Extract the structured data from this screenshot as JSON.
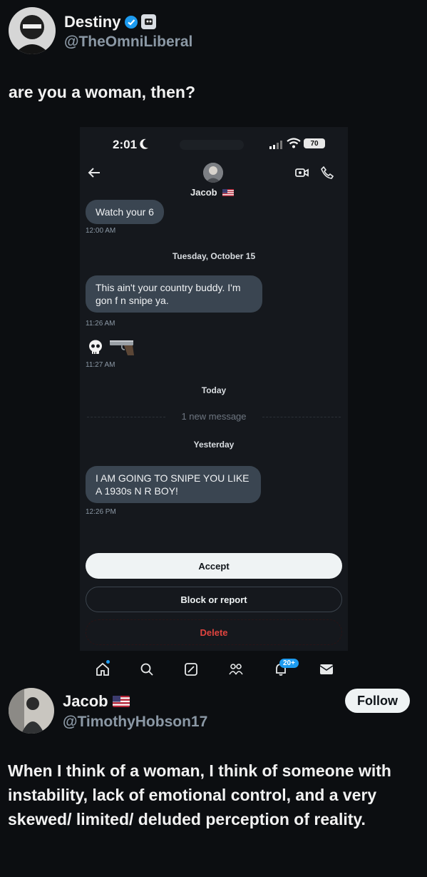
{
  "post": {
    "display_name": "Destiny",
    "handle": "@TheOmniLiberal",
    "text": "are you a woman, then?"
  },
  "screenshot": {
    "status": {
      "time": "2:01",
      "battery": "70"
    },
    "chat": {
      "contact_name": "Jacob",
      "messages": [
        {
          "text": "Watch your 6",
          "time": "12:00 AM"
        },
        {
          "text": "This ain't your country buddy. I'm gon f       n snipe ya.",
          "time": "11:26 AM"
        },
        {
          "text": "💀 🔫",
          "time": "11:27 AM"
        },
        {
          "text": "I AM GOING TO SNIPE YOU LIKE A 1930s N         R BOY!",
          "time": "12:26 PM"
        }
      ],
      "day_separators": [
        "Tuesday, October 15",
        "Today",
        "Yesterday"
      ],
      "new_message_label": "1 new message"
    },
    "actions": {
      "accept": "Accept",
      "block_report": "Block or report",
      "delete": "Delete"
    },
    "tabbar": {
      "notification_count": "20+"
    }
  },
  "reply": {
    "display_name": "Jacob",
    "handle": "@TimothyHobson17",
    "follow_label": "Follow",
    "text": "When I think of a woman, I think of someone with instability, lack of emotional control, and a very skewed/ limited/ deluded perception of reality."
  },
  "colors": {
    "background": "#0c0e11",
    "accent": "#1d9bf0",
    "bubble": "#3a4551",
    "delete": "#e0443f"
  }
}
